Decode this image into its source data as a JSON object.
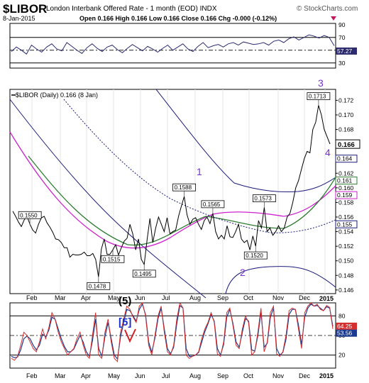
{
  "header": {
    "symbol": "$LIBOR",
    "name": "London Interbank Offered Rate - 1 month (EOD)  INDX",
    "watermark": "© StockCharts.com",
    "date": "8-Jan-2015",
    "ohlc": "Open 0.166  High 0.166  Low 0.166  Close 0.166  Chg -0.000 (-0.12%)"
  },
  "colors": {
    "background": "#ffffff",
    "frame": "#000000",
    "price": "#000000",
    "envelope": "#1c1c7a",
    "ma_short": "#cc22cc",
    "ma_mid": "#2e7d32",
    "ma_long": "#8b0000",
    "trend": "#1c1c7a",
    "stoch_k": "#d32f2f",
    "stoch_d": "#1a3a8f",
    "wave_purple": "#7d2ed0",
    "wave_blue": "#1a2fd0",
    "wave_red": "#d32020"
  },
  "x_axis": {
    "months": [
      "Feb",
      "Mar",
      "Apr",
      "May",
      "Jun",
      "Jul",
      "Aug",
      "Sep",
      "Oct",
      "Nov",
      "Dec",
      "2015"
    ]
  },
  "chart_data": [
    {
      "panel": "rsi",
      "type": "line",
      "ylim": [
        22,
        92
      ],
      "ticks": [
        30,
        50,
        70,
        90
      ],
      "tag": "57.27",
      "values": [
        48,
        55,
        50,
        44,
        58,
        52,
        47,
        55,
        60,
        52,
        49,
        62,
        56,
        50,
        45,
        54,
        60,
        53,
        48,
        55,
        58,
        51,
        46,
        53,
        59,
        54,
        49,
        56,
        52,
        47,
        53,
        58,
        50,
        55,
        60,
        52,
        48,
        56,
        62,
        54,
        57,
        59,
        55,
        60,
        62,
        58,
        63,
        61,
        59,
        60,
        62,
        58,
        64,
        66,
        62,
        68,
        71,
        66,
        70,
        74,
        72,
        69,
        73,
        70,
        57
      ]
    },
    {
      "panel": "price",
      "type": "line",
      "legend": "$LIBOR (Daily) 0.166 (8 Jan)",
      "ylim": [
        0.1455,
        0.1735
      ],
      "y_ticks": [
        "0.172",
        "0.170",
        "0.168",
        "0.166",
        "0.164",
        "0.162",
        "0.161",
        "0.160",
        "0.159",
        "0.158",
        "0.156",
        "0.155",
        "0.154",
        "0.152",
        "0.150",
        "0.148",
        "0.146"
      ],
      "series": [
        {
          "values": [
            0.1568,
            0.1561,
            0.1553,
            0.1547,
            0.1556,
            0.1561,
            0.155,
            0.1542,
            0.1538,
            0.155,
            0.1559,
            0.1561,
            0.1552,
            0.1546,
            0.1539,
            0.153,
            0.1529,
            0.1525,
            0.1518,
            0.1518,
            0.1505,
            0.1509,
            0.1508,
            0.1508,
            0.1509,
            0.1512,
            0.1507,
            0.1507,
            0.151,
            0.1502,
            0.1478,
            0.1516,
            0.153,
            0.1509,
            0.1509,
            0.1515,
            0.1522,
            0.1508,
            0.1518,
            0.1527,
            0.1531,
            0.155,
            0.1537,
            0.1515,
            0.153,
            0.1502,
            0.1495,
            0.1529,
            0.1558,
            0.1525,
            0.1545,
            0.156,
            0.155,
            0.154,
            0.1559,
            0.1537,
            0.154,
            0.1542,
            0.1561,
            0.1575,
            0.1588,
            0.1563,
            0.155,
            0.1557,
            0.1559,
            0.155,
            0.1543,
            0.1555,
            0.156,
            0.1551,
            0.1565,
            0.154,
            0.153,
            0.1535,
            0.153,
            0.1548,
            0.1533,
            0.1532,
            0.154,
            0.155,
            0.153,
            0.1525,
            0.1528,
            0.1515,
            0.1534,
            0.152,
            0.1555,
            0.1545,
            0.1573,
            0.154,
            0.1545,
            0.1535,
            0.154,
            0.1548,
            0.154,
            0.1545,
            0.156,
            0.1565,
            0.158,
            0.16,
            0.161,
            0.1625,
            0.164,
            0.165,
            0.1648,
            0.168,
            0.169,
            0.1713,
            0.17,
            0.168,
            0.167,
            0.166
          ]
        }
      ],
      "price_labels": [
        "0.1713",
        "0.1588",
        "0.1573",
        "0.1565",
        "0.1550",
        "0.1520",
        "0.1515",
        "0.1495",
        "0.1478"
      ],
      "tags": [
        "0.166",
        "0.164",
        "0.161",
        "0.159",
        "0.155"
      ],
      "waves": [
        "1",
        "2",
        "3",
        "4"
      ]
    },
    {
      "panel": "stochastic",
      "type": "line",
      "ylim": [
        0,
        100
      ],
      "ticks": [
        20,
        50,
        80
      ],
      "tags": [
        "64.25",
        "53.56"
      ],
      "series": [
        {
          "name": "%K",
          "values": [
            15,
            12,
            18,
            35,
            55,
            50,
            40,
            30,
            25,
            40,
            60,
            45,
            62,
            85,
            75,
            55,
            40,
            30,
            20,
            25,
            30,
            45,
            55,
            35,
            20,
            15,
            50,
            85,
            20,
            15,
            55,
            75,
            40,
            15,
            10,
            55,
            75,
            95,
            90,
            78,
            70,
            95,
            100,
            80,
            35,
            20,
            50,
            80,
            95,
            55,
            25,
            20,
            35,
            75,
            100,
            92,
            20,
            15,
            18,
            20,
            25,
            45,
            60,
            70,
            85,
            70,
            22,
            18,
            40,
            85,
            92,
            65,
            35,
            30,
            60,
            80,
            70,
            20,
            25,
            55,
            92,
            25,
            40,
            85,
            95,
            22,
            18,
            25,
            50,
            88,
            92,
            90,
            60,
            30,
            85,
            95,
            100,
            95,
            98,
            90,
            88,
            96,
            93,
            60
          ]
        },
        {
          "name": "%D",
          "values": [
            18,
            16,
            17,
            28,
            45,
            49,
            45,
            35,
            28,
            35,
            52,
            48,
            58,
            78,
            75,
            60,
            45,
            33,
            25,
            25,
            29,
            40,
            50,
            40,
            25,
            18,
            42,
            75,
            30,
            18,
            48,
            70,
            45,
            20,
            14,
            48,
            70,
            90,
            88,
            80,
            72,
            90,
            98,
            82,
            40,
            24,
            46,
            76,
            92,
            60,
            30,
            22,
            32,
            68,
            96,
            92,
            30,
            18,
            18,
            20,
            24,
            40,
            56,
            68,
            82,
            72,
            30,
            20,
            36,
            78,
            90,
            68,
            40,
            32,
            55,
            76,
            72,
            28,
            26,
            50,
            86,
            32,
            38,
            78,
            92,
            30,
            20,
            24,
            44,
            82,
            90,
            90,
            66,
            36,
            78,
            92,
            98,
            95,
            96,
            92,
            88,
            94,
            92,
            64
          ]
        }
      ],
      "labels": [
        "(5)",
        "[5]"
      ]
    }
  ]
}
